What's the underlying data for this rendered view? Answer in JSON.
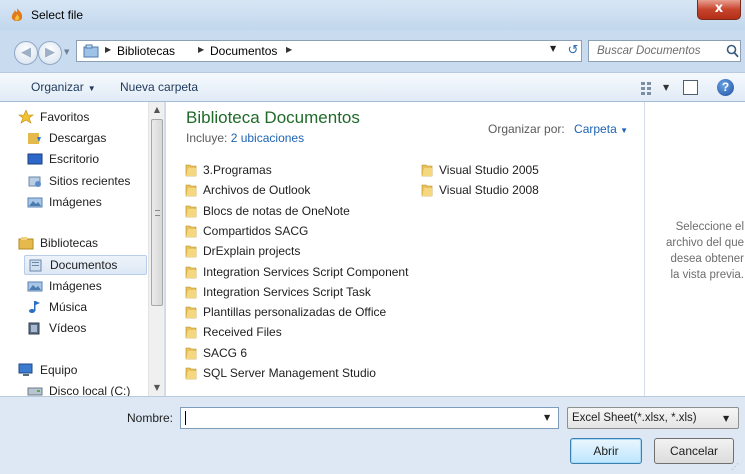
{
  "window": {
    "title": "Select file",
    "close_label": "x"
  },
  "address": {
    "segments": [
      "Bibliotecas",
      "Documentos"
    ],
    "search_placeholder": "Buscar Documentos"
  },
  "toolbar": {
    "organize_label": "Organizar",
    "new_folder_label": "Nueva carpeta"
  },
  "nav": {
    "items": [
      {
        "label": "Favoritos",
        "icon": "star-icon"
      },
      {
        "label": "Descargas",
        "icon": "downloads-folder-icon"
      },
      {
        "label": "Escritorio",
        "icon": "desktop-icon"
      },
      {
        "label": "Sitios recientes",
        "icon": "recent-places-icon"
      },
      {
        "label": "Imágenes",
        "icon": "pictures-icon"
      },
      {
        "label": "Bibliotecas",
        "icon": "libraries-icon"
      },
      {
        "label": "Documentos",
        "icon": "documents-icon",
        "selected": true
      },
      {
        "label": "Imágenes",
        "icon": "pictures-icon"
      },
      {
        "label": "Música",
        "icon": "music-icon"
      },
      {
        "label": "Vídeos",
        "icon": "videos-icon"
      },
      {
        "label": "Equipo",
        "icon": "computer-icon"
      },
      {
        "label": "Disco local (C:)",
        "icon": "local-disk-icon"
      }
    ]
  },
  "content": {
    "title": "Biblioteca Documentos",
    "includes_label": "Incluye:",
    "includes_link": "2 ubicaciones",
    "arrange_label": "Organizar por:",
    "arrange_value": "Carpeta",
    "folders_col1": [
      "3.Programas",
      "Archivos de Outlook",
      "Blocs de notas de OneNote",
      "Compartidos SACG",
      "DrExplain projects",
      "Integration Services Script Component",
      "Integration Services Script Task",
      "Plantillas personalizadas de Office",
      "Received Files",
      "SACG 6",
      "SQL Server Management Studio"
    ],
    "folders_col2": [
      "Visual Studio 2005",
      "Visual Studio 2008"
    ]
  },
  "preview": {
    "lines": [
      "Seleccione el",
      "archivo del que",
      "desea obtener",
      "la vista previa."
    ]
  },
  "bottom": {
    "name_label": "Nombre:",
    "name_value": "",
    "file_type": "Excel Sheet(*.xlsx, *.xls)",
    "open_label": "Abrir",
    "cancel_label": "Cancelar"
  },
  "colors": {
    "title_green": "#1f6a2a",
    "link_blue": "#1e64b4",
    "folder_yellow": "#e8c25a"
  }
}
